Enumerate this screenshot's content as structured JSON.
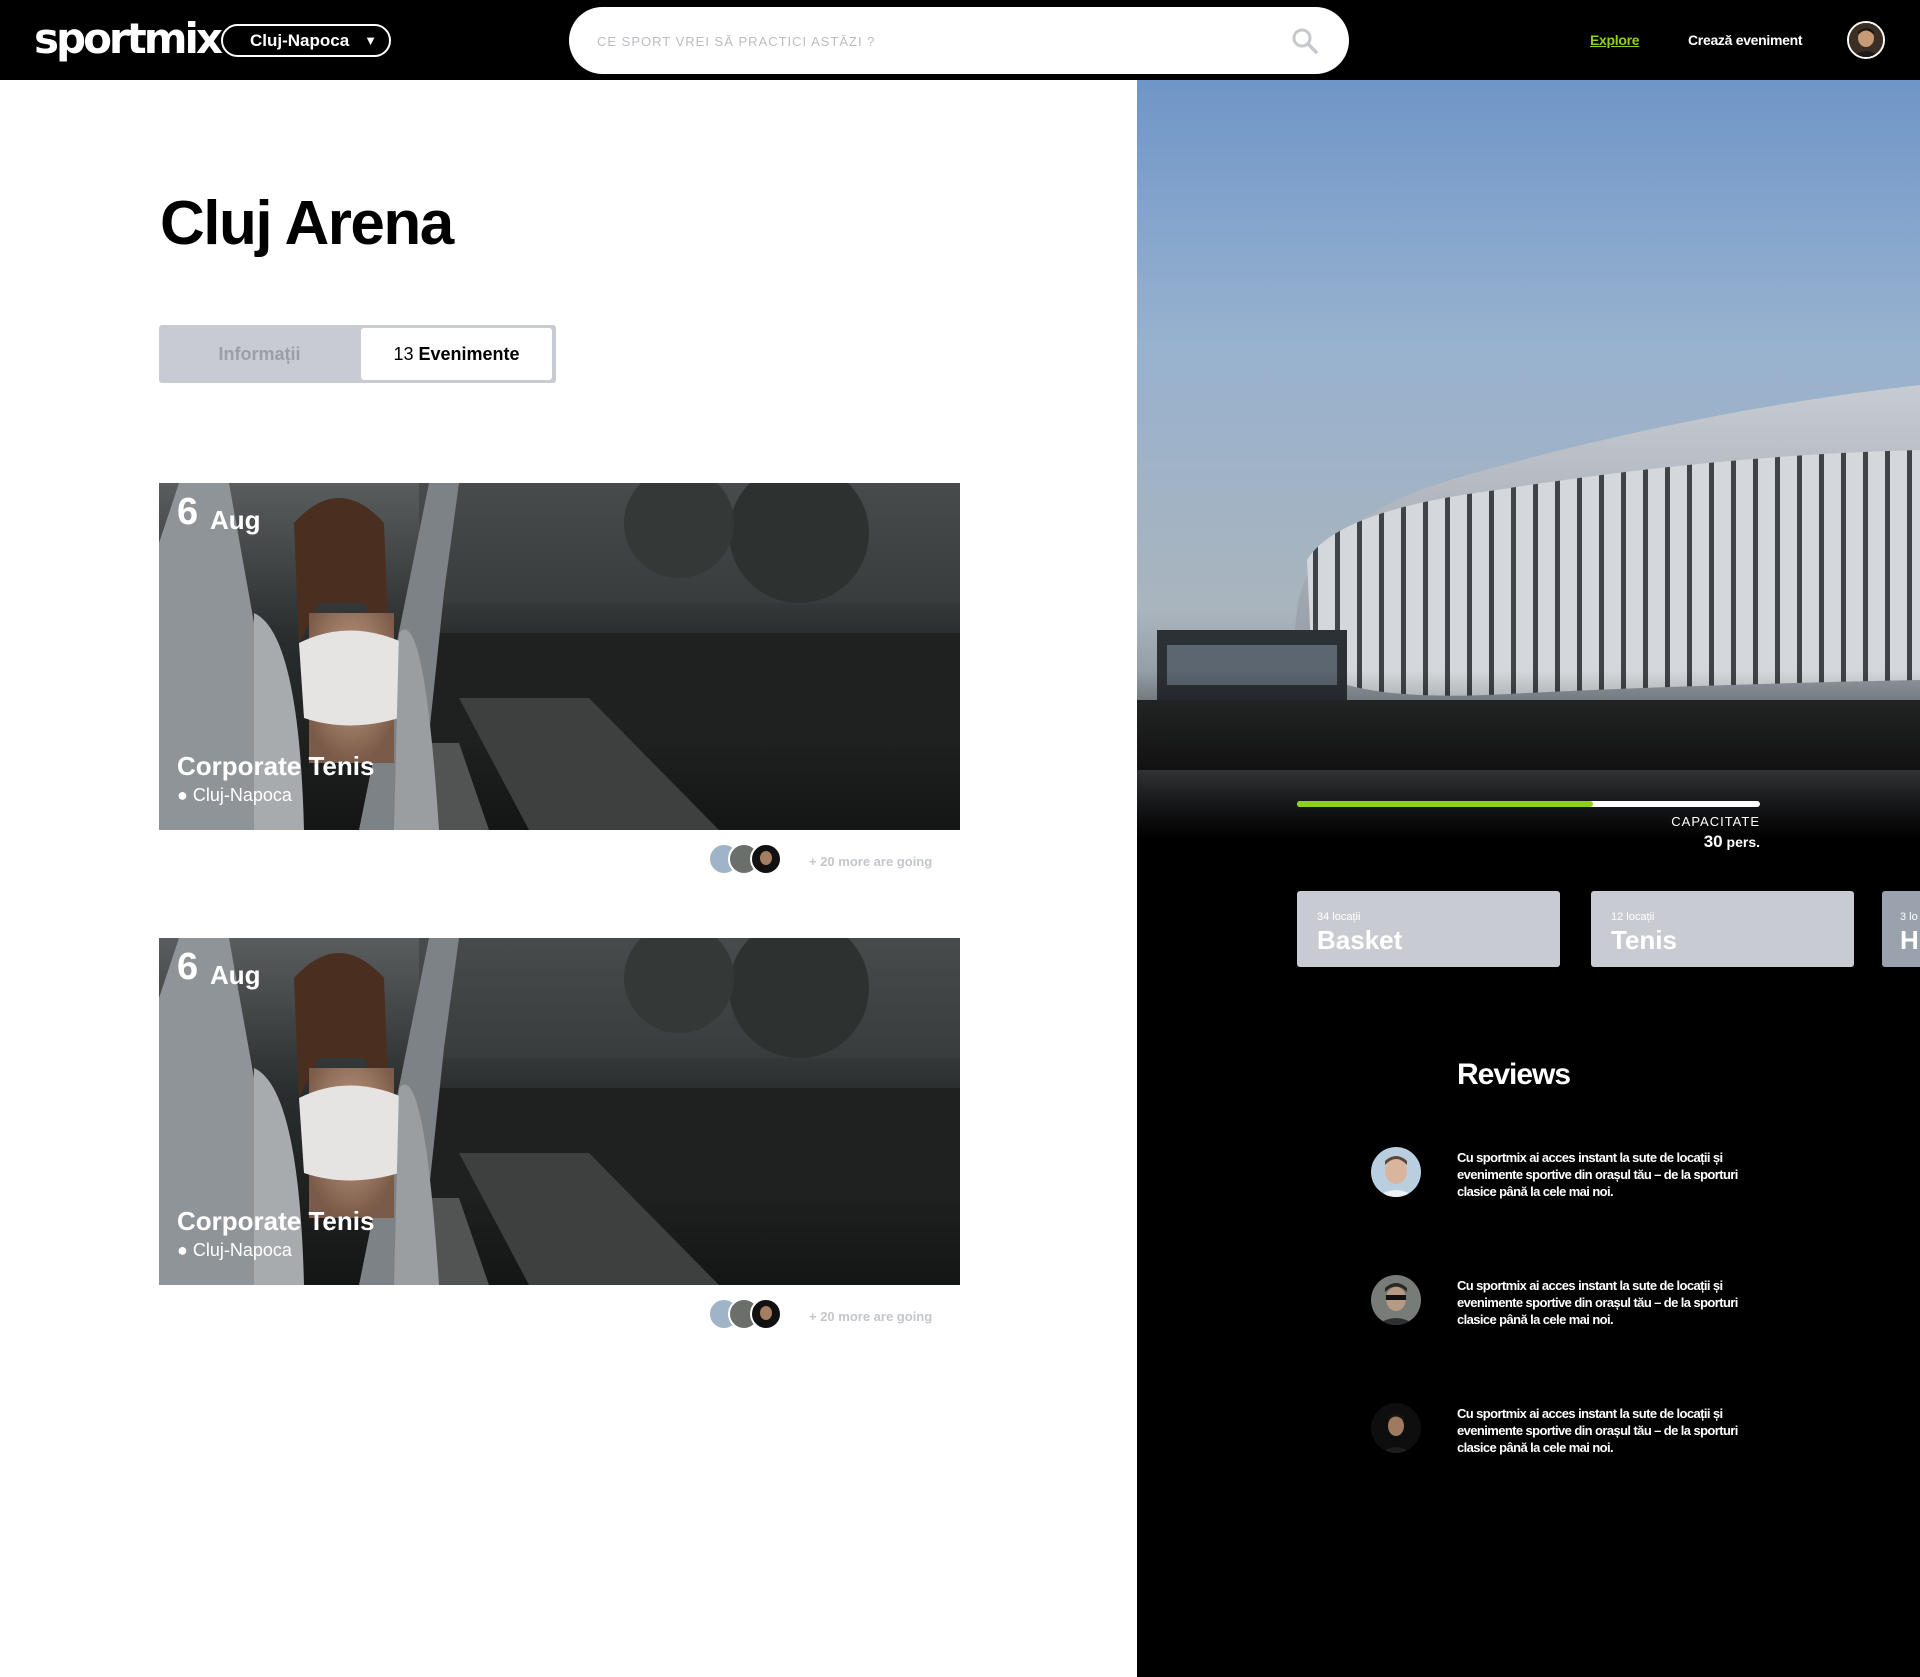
{
  "header": {
    "logo": "sportmix",
    "city": "Cluj-Napoca",
    "search_placeholder": "CE SPORT VREI SĂ PRACTICI ASTĂZI ?",
    "nav": {
      "explore": "Explore",
      "create_event": "Crează eveniment"
    }
  },
  "venue": {
    "title": "Cluj Arena",
    "tabs": {
      "info": "Informații",
      "events_count": "13",
      "events_label": "Evenimente"
    }
  },
  "events": [
    {
      "day": "6",
      "month": "Aug",
      "title": "Corporate Tenis",
      "location": "● Cluj-Napoca",
      "more_going": "+ 20 more are going"
    },
    {
      "day": "6",
      "month": "Aug",
      "title": "Corporate Tenis",
      "location": "● Cluj-Napoca",
      "more_going": "+ 20 more are going"
    }
  ],
  "capacity": {
    "label": "CAPACITATE",
    "value": "30",
    "unit": "pers.",
    "fill_fraction": 0.64
  },
  "sports": [
    {
      "count": "34 locații",
      "name": "Basket"
    },
    {
      "count": "12 locații",
      "name": "Tenis"
    },
    {
      "count": "3 lo",
      "name": "H"
    }
  ],
  "reviews": {
    "title": "Reviews",
    "items": [
      {
        "text": "Cu sportmix ai acces instant la sute de locații și evenimente sportive din orașul tău – de la sporturi clasice până la cele mai noi."
      },
      {
        "text": "Cu sportmix ai acces instant la sute de locații și evenimente sportive din orașul tău – de la sporturi clasice până la cele mai noi."
      },
      {
        "text": "Cu sportmix ai acces instant la sute de locații și evenimente sportive din orașul tău – de la sporturi clasice până la cele mai noi."
      }
    ]
  },
  "colors": {
    "accent": "#8fd11a",
    "tab_bg": "#c8ccd2",
    "muted": "#c3c6cc"
  }
}
